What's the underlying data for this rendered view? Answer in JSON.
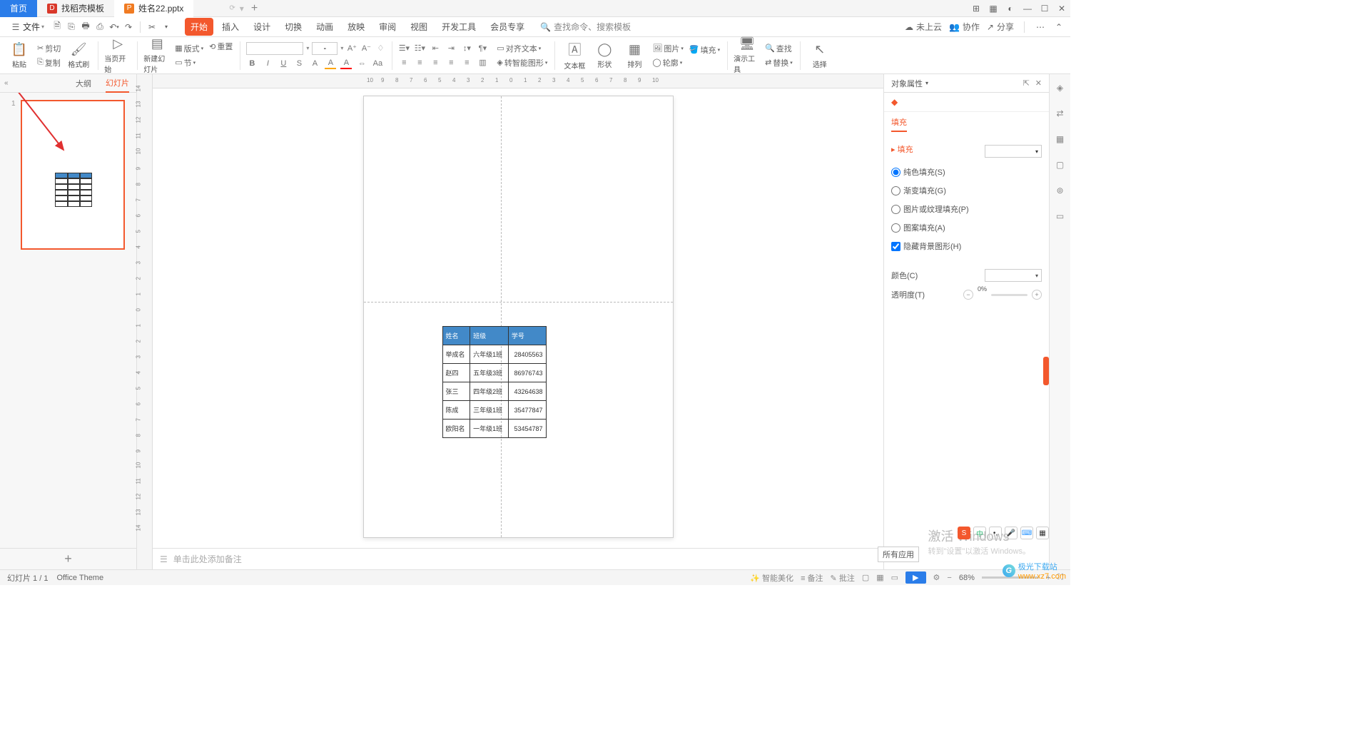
{
  "titlebar": {
    "home": "首页",
    "tabs": [
      {
        "label": "找稻壳模板",
        "icon": "D"
      },
      {
        "label": "姓名22.pptx",
        "icon": "P"
      }
    ],
    "add_tab": "+"
  },
  "menubar": {
    "file": "文件",
    "tabs": [
      "开始",
      "插入",
      "设计",
      "切换",
      "动画",
      "放映",
      "审阅",
      "视图",
      "开发工具",
      "会员专享"
    ],
    "active": 0,
    "search_placeholder": "查找命令、搜索模板",
    "cloud": "未上云",
    "collab": "协作",
    "share": "分享"
  },
  "ribbon": {
    "paste": "粘贴",
    "cut": "剪切",
    "copy": "复制",
    "format_painter": "格式刷",
    "from_start": "当页开始",
    "new_slide": "新建幻灯片",
    "format": "版式",
    "section": "节",
    "reset": "重置",
    "align_text": "对齐文本",
    "convert_smart": "转智能图形",
    "textbox": "文本框",
    "shape": "形状",
    "arrange": "排列",
    "image": "图片",
    "fill": "填充",
    "outline": "轮廓",
    "find": "查找",
    "replace": "替换",
    "demo_tools": "演示工具",
    "select": "选择"
  },
  "left_pane": {
    "collapse": "«",
    "tab_outline": "大纲",
    "tab_slides": "幻灯片",
    "slide_num": "1",
    "add": "+"
  },
  "table": {
    "headers": [
      "姓名",
      "班级",
      "学号"
    ],
    "rows": [
      [
        "举成名",
        "六年级1班",
        "28405563"
      ],
      [
        "赵四",
        "五年级3班",
        "86976743"
      ],
      [
        "张三",
        "四年级2班",
        "43264638"
      ],
      [
        "陈成",
        "三年级1班",
        "35477847"
      ],
      [
        "欧阳名",
        "一年级1班",
        "53454787"
      ]
    ]
  },
  "notes_placeholder": "单击此处添加备注",
  "right_panel": {
    "title": "对象属性",
    "tab": "填充",
    "section": "填充",
    "opt_solid": "纯色填充(S)",
    "opt_gradient": "渐变填充(G)",
    "opt_picture": "图片或纹理填充(P)",
    "opt_pattern": "图案填充(A)",
    "opt_hide": "隐藏背景图形(H)",
    "color_label": "颜色(C)",
    "opacity_label": "透明度(T)",
    "opacity_value": "0%"
  },
  "statusbar": {
    "page": "幻灯片 1 / 1",
    "theme": "Office Theme",
    "smart": "智能美化",
    "notes": "备注",
    "comments": "批注",
    "zoom": "68%"
  },
  "watermark": {
    "title": "激活 Windows",
    "sub": "转到\"设置\"以激活 Windows。",
    "all_apps": "所有应用"
  },
  "ruler_h": [
    "10",
    "9",
    "8",
    "7",
    "6",
    "5",
    "4",
    "3",
    "2",
    "1",
    "0",
    "1",
    "2",
    "3",
    "4",
    "5",
    "6",
    "7",
    "8",
    "9",
    "10"
  ],
  "ruler_v": [
    "14",
    "13",
    "12",
    "11",
    "10",
    "9",
    "8",
    "7",
    "6",
    "5",
    "4",
    "3",
    "2",
    "1",
    "0",
    "1",
    "2",
    "3",
    "4",
    "5",
    "6",
    "7",
    "8",
    "9",
    "10",
    "11",
    "12",
    "13",
    "14"
  ],
  "site": {
    "name": "极光下载站",
    "url": "www.xz7.com"
  }
}
